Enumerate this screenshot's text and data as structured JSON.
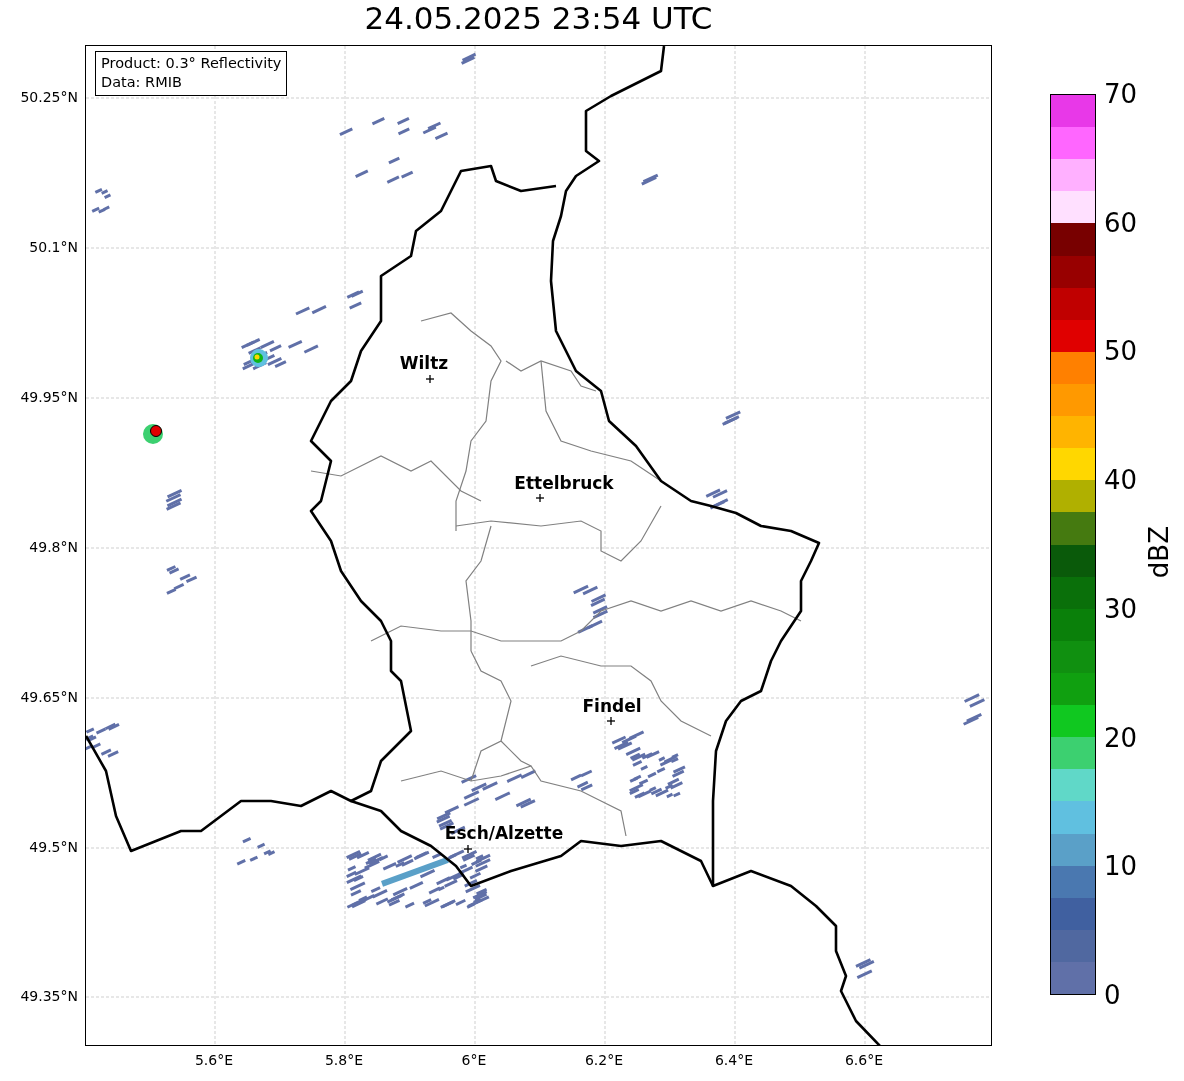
{
  "title": "24.05.2025 23:54 UTC",
  "legend": [
    "Product: 0.3° Reflectivity",
    "Data: RMIB"
  ],
  "yticks": [
    "50.25°N",
    "50.1°N",
    "49.95°N",
    "49.8°N",
    "49.65°N",
    "49.5°N",
    "49.35°N"
  ],
  "xticks": [
    "5.6°E",
    "5.8°E",
    "6°E",
    "6.2°E",
    "6.4°E",
    "6.6°E"
  ],
  "cities": [
    {
      "name": "Wiltz"
    },
    {
      "name": "Ettelbruck"
    },
    {
      "name": "Findel"
    },
    {
      "name": "Esch/Alzette"
    }
  ],
  "colorbar": {
    "label": "dBZ",
    "ticks": [
      "70",
      "60",
      "50",
      "40",
      "30",
      "20",
      "10",
      "0"
    ],
    "segments": [
      {
        "color": "#e838e8"
      },
      {
        "color": "#ff66ff"
      },
      {
        "color": "#ffb0ff"
      },
      {
        "color": "#ffe0ff"
      },
      {
        "color": "#780000"
      },
      {
        "color": "#980000"
      },
      {
        "color": "#c00000"
      },
      {
        "color": "#e00000"
      },
      {
        "color": "#ff8000"
      },
      {
        "color": "#ff9900"
      },
      {
        "color": "#ffb400"
      },
      {
        "color": "#ffd700"
      },
      {
        "color": "#b0b000"
      },
      {
        "color": "#457a10"
      },
      {
        "color": "#0a5a0a"
      },
      {
        "color": "#0a700a"
      },
      {
        "color": "#0a800a"
      },
      {
        "color": "#109010"
      },
      {
        "color": "#10a010"
      },
      {
        "color": "#10c820"
      },
      {
        "color": "#3cd070"
      },
      {
        "color": "#60d8c8"
      },
      {
        "color": "#60c0e0"
      },
      {
        "color": "#5aa0c8"
      },
      {
        "color": "#4a78b0"
      },
      {
        "color": "#4060a0"
      },
      {
        "color": "#5068a0"
      },
      {
        "color": "#6070a8"
      }
    ]
  }
}
